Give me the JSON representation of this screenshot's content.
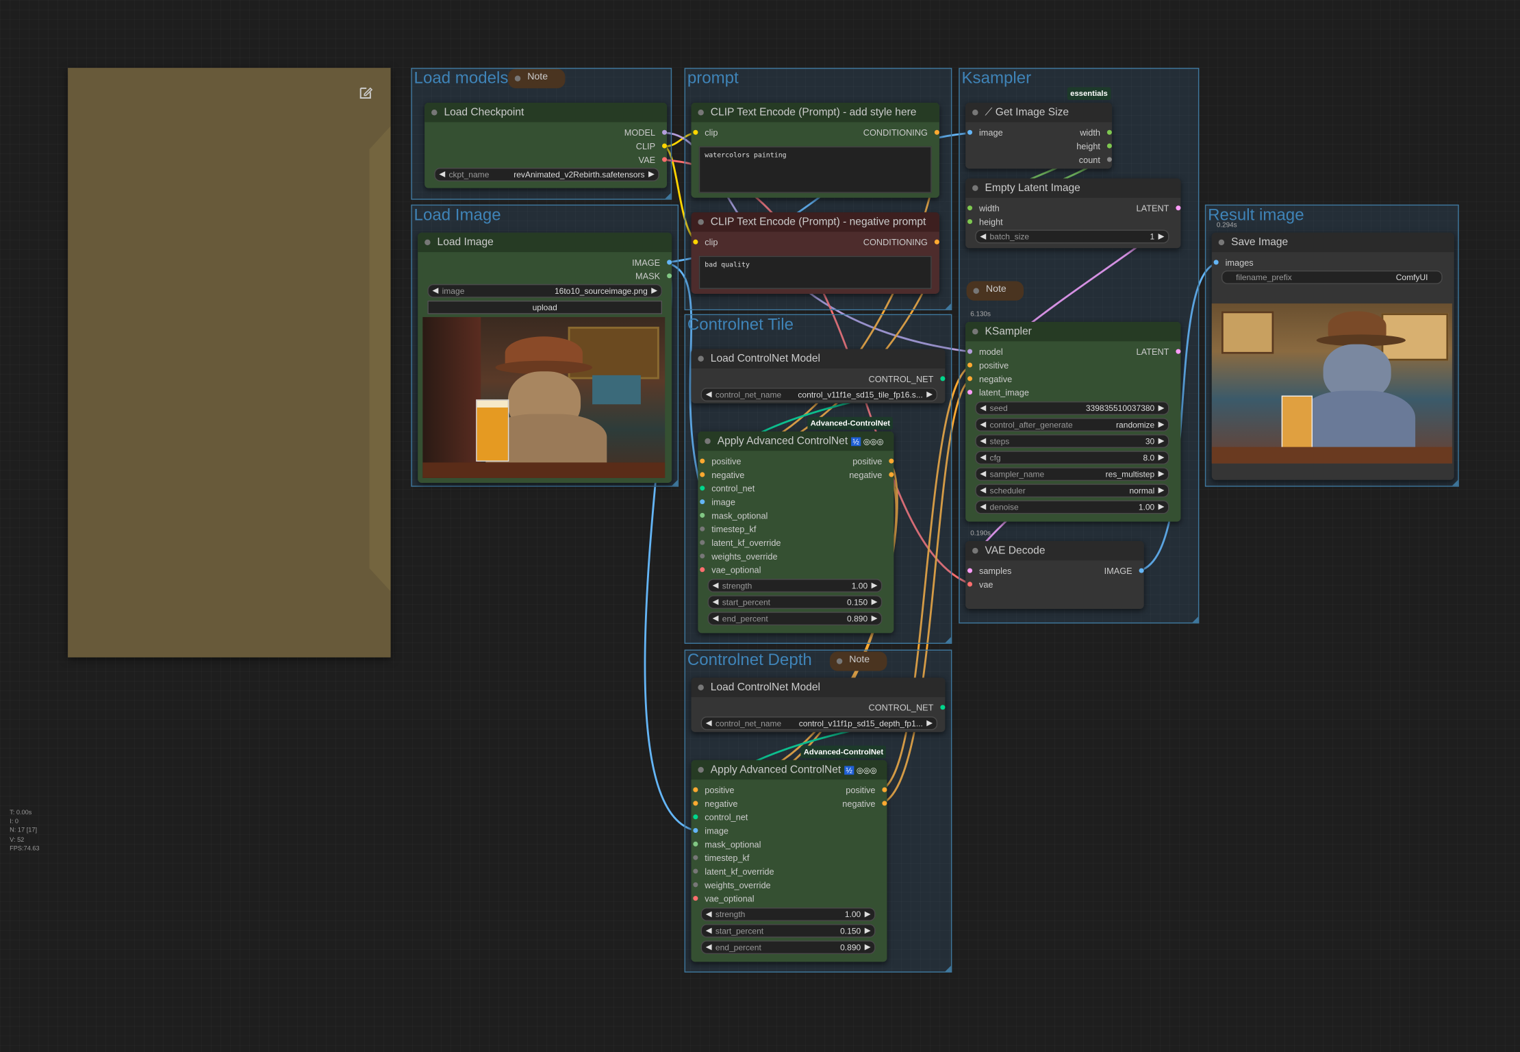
{
  "colors": {
    "model": "#b39ddb",
    "clip": "#ffd500",
    "vae": "#ff6e6e",
    "conditioning": "#ffa931",
    "image": "#64b5f6",
    "mask": "#81c784",
    "latent": "#ff9cf9",
    "control_net": "#00d78d",
    "int": "#7ec850"
  },
  "stats": {
    "t": "T: 0.00s",
    "i": "I: 0",
    "n": "N: 17 [17]",
    "v": "V: 52",
    "fps": "FPS:74.63"
  },
  "groups": {
    "load_models": "Load models",
    "load_image": "Load Image",
    "prompt": "prompt",
    "ksampler": "Ksampler",
    "result": "Result image",
    "cn_tile": "Controlnet Tile",
    "cn_depth": "Controlnet Depth"
  },
  "notes": {
    "n1": "Note",
    "n2": "Note",
    "n3": "Note"
  },
  "badges": {
    "essentials": "essentials",
    "adv1": "Advanced-ControlNet",
    "adv2": "Advanced-ControlNet"
  },
  "timings": {
    "t1": "0.294s",
    "t2": "6.130s",
    "t3": "0.190s"
  },
  "load_checkpoint": {
    "title": "Load Checkpoint",
    "out_model": "MODEL",
    "out_clip": "CLIP",
    "out_vae": "VAE",
    "w_label": "ckpt_name",
    "w_value": "revAnimated_v2Rebirth.safetensors"
  },
  "load_image": {
    "title": "Load Image",
    "out_image": "IMAGE",
    "out_mask": "MASK",
    "w_label": "image",
    "w_value": "16to10_sourceimage.png",
    "upload": "upload"
  },
  "clip_pos": {
    "title": "CLIP Text Encode (Prompt) -  add style here",
    "in_clip": "clip",
    "out": "CONDITIONING",
    "text": "watercolors painting"
  },
  "clip_neg": {
    "title": "CLIP Text Encode (Prompt) - negative prompt",
    "in_clip": "clip",
    "out": "CONDITIONING",
    "text": "bad quality"
  },
  "get_size": {
    "title": "Get Image Size",
    "in_image": "image",
    "out_width": "width",
    "out_height": "height",
    "out_count": "count"
  },
  "empty_latent": {
    "title": "Empty Latent Image",
    "in_width": "width",
    "in_height": "height",
    "out": "LATENT",
    "w_label": "batch_size",
    "w_value": "1"
  },
  "ksampler": {
    "title": "KSampler",
    "in_model": "model",
    "in_positive": "positive",
    "in_negative": "negative",
    "in_latent": "latent_image",
    "out": "LATENT",
    "widgets": [
      {
        "label": "seed",
        "value": "339835510037380"
      },
      {
        "label": "control_after_generate",
        "value": "randomize"
      },
      {
        "label": "steps",
        "value": "30"
      },
      {
        "label": "cfg",
        "value": "8.0"
      },
      {
        "label": "sampler_name",
        "value": "res_multistep"
      },
      {
        "label": "scheduler",
        "value": "normal"
      },
      {
        "label": "denoise",
        "value": "1.00"
      }
    ]
  },
  "vae_decode": {
    "title": "VAE Decode",
    "in_samples": "samples",
    "in_vae": "vae",
    "out": "IMAGE"
  },
  "save_image": {
    "title": "Save Image",
    "in_images": "images",
    "w_label": "filename_prefix",
    "w_value": "ComfyUI"
  },
  "cn_load_tile": {
    "title": "Load ControlNet Model",
    "out": "CONTROL_NET",
    "w_label": "control_net_name",
    "w_value": "control_v11f1e_sd15_tile_fp16.s..."
  },
  "cn_load_depth": {
    "title": "Load ControlNet Model",
    "out": "CONTROL_NET",
    "w_label": "control_net_name",
    "w_value": "control_v11f1p_sd15_depth_fp1..."
  },
  "apply_tile": {
    "title": "Apply Advanced ControlNet",
    "inputs": [
      "positive",
      "negative",
      "control_net",
      "image",
      "mask_optional",
      "timestep_kf",
      "latent_kf_override",
      "weights_override",
      "vae_optional"
    ],
    "out_pos": "positive",
    "out_neg": "negative",
    "widgets": [
      {
        "label": "strength",
        "value": "1.00"
      },
      {
        "label": "start_percent",
        "value": "0.150"
      },
      {
        "label": "end_percent",
        "value": "0.890"
      }
    ]
  },
  "apply_depth": {
    "title": "Apply Advanced ControlNet",
    "inputs": [
      "positive",
      "negative",
      "control_net",
      "image",
      "mask_optional",
      "timestep_kf",
      "latent_kf_override",
      "weights_override",
      "vae_optional"
    ],
    "out_pos": "positive",
    "out_neg": "negative",
    "widgets": [
      {
        "label": "strength",
        "value": "1.00"
      },
      {
        "label": "start_percent",
        "value": "0.150"
      },
      {
        "label": "end_percent",
        "value": "0.890"
      }
    ]
  }
}
